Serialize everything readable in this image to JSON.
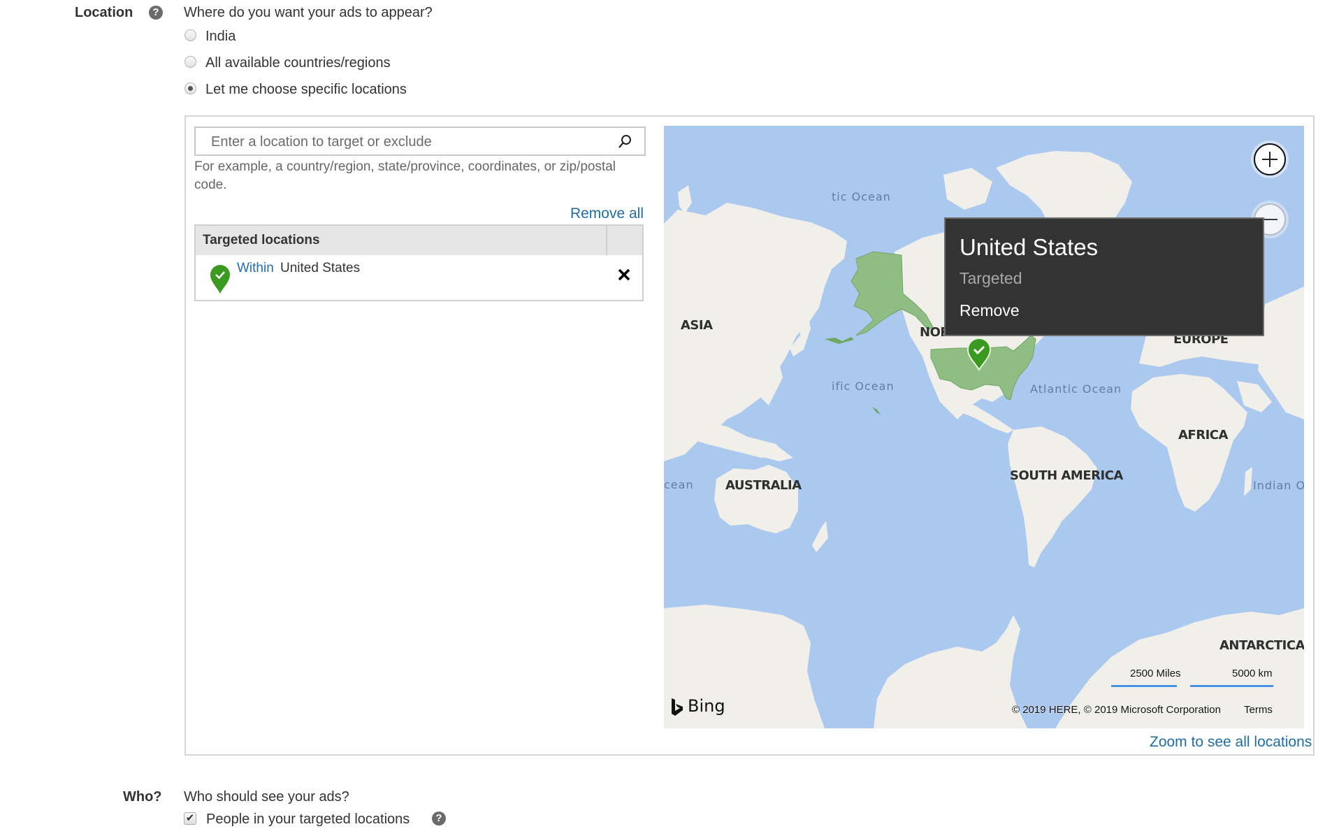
{
  "location_section": {
    "label": "Location",
    "help_icon": "question-circle-icon",
    "question": "Where do you want your ads to appear?",
    "options": [
      {
        "label": "India",
        "selected": false
      },
      {
        "label": "All available countries/regions",
        "selected": false
      },
      {
        "label": "Let me choose specific locations",
        "selected": true
      }
    ]
  },
  "location_picker": {
    "search": {
      "placeholder": "Enter a location to target or exclude",
      "value": "",
      "icon": "search-icon"
    },
    "hint": "For example, a country/region, state/province, coordinates, or zip/postal code.",
    "remove_all_label": "Remove all",
    "table": {
      "header": "Targeted locations",
      "rows": [
        {
          "icon": "targeted-pin-icon",
          "qualifier": "Within",
          "location": "United States",
          "remove_icon": "close-icon"
        }
      ]
    },
    "zoom_all_label": "Zoom to see all locations"
  },
  "map": {
    "ocean_labels": [
      "tic Ocean",
      "ific Ocean",
      "Atlantic Ocean",
      "cean",
      "Indian O"
    ],
    "continent_labels": [
      "ASIA",
      "NOR",
      "EUROPE",
      "AFRICA",
      "SOUTH AMERICA",
      "AUSTRALIA",
      "ANTARCTICA"
    ],
    "tooltip": {
      "title": "United States",
      "status": "Targeted",
      "action": "Remove"
    },
    "zoom_in_icon": "plus-circle-icon",
    "zoom_out_icon": "minus-circle-icon",
    "scale": {
      "miles": "2500 Miles",
      "km": "5000 km"
    },
    "copyright": "© 2019 HERE, © 2019 Microsoft Corporation",
    "terms_label": "Terms",
    "brand": "Bing",
    "colors": {
      "water": "#abc8ef",
      "land": "#f0efea",
      "targeted": "#8fbd84",
      "pin": "#3a9a1f"
    }
  },
  "who_section": {
    "label": "Who?",
    "question": "Who should see your ads?",
    "checkbox": {
      "label": "People in your targeted locations",
      "checked": true
    },
    "help_icon": "question-circle-icon"
  }
}
